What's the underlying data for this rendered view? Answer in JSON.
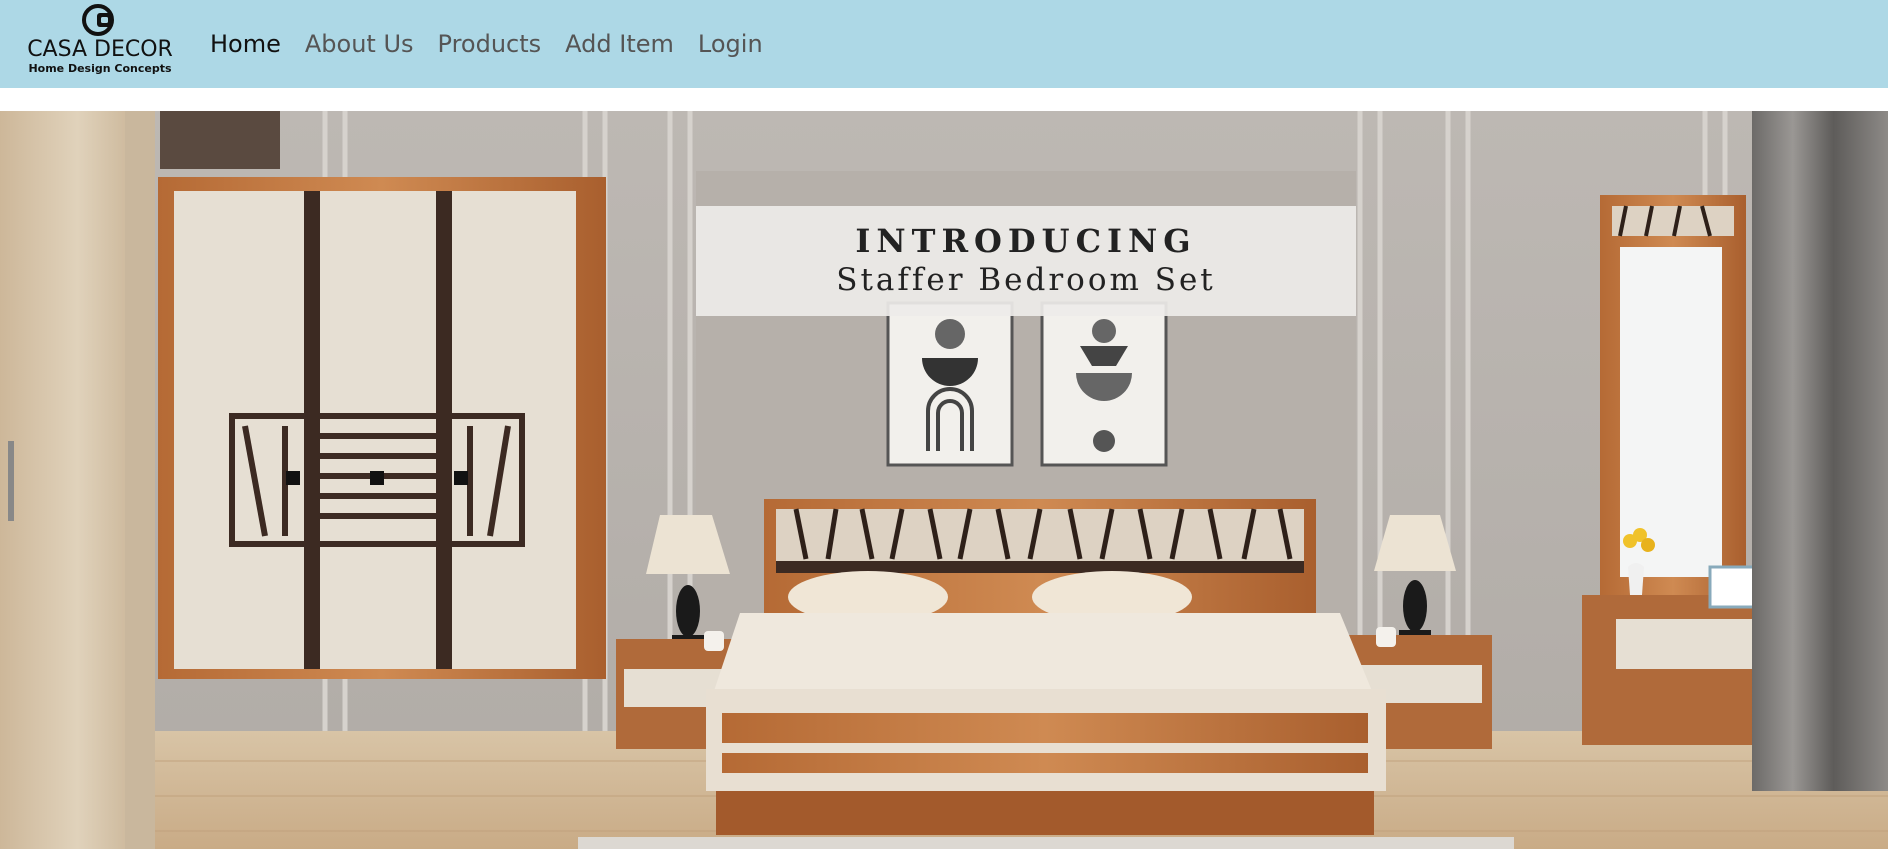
{
  "brand": {
    "name": "CASA DECOR",
    "tagline": "Home Design Concepts"
  },
  "nav": {
    "items": [
      {
        "label": "Home",
        "active": true
      },
      {
        "label": "About Us",
        "active": false
      },
      {
        "label": "Products",
        "active": false
      },
      {
        "label": "Add Item",
        "active": false
      },
      {
        "label": "Login",
        "active": false
      }
    ]
  },
  "hero": {
    "headline": "INTRODUCING",
    "subheadline": "Staffer Bedroom Set"
  },
  "colors": {
    "navbar_bg": "#add8e6",
    "active_link": "#111111",
    "inactive_link": "#555555"
  }
}
